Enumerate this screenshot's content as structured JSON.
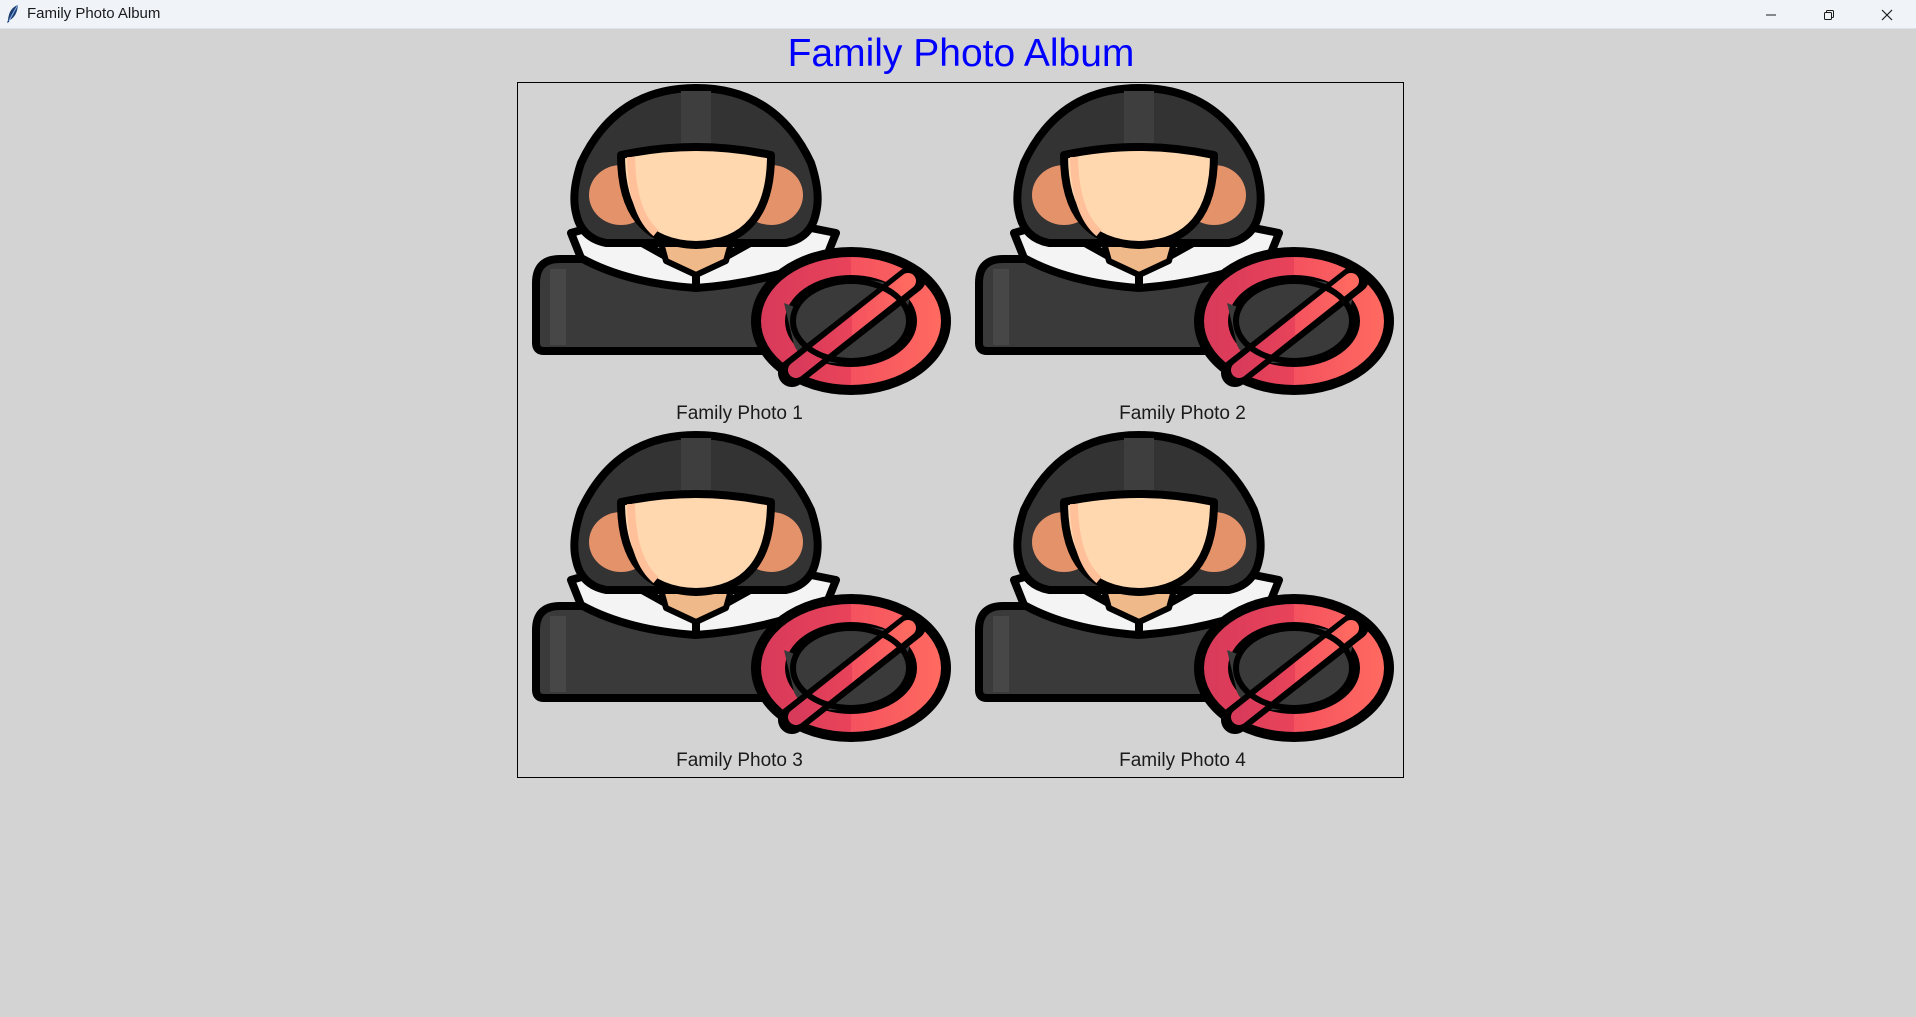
{
  "window": {
    "title": "Family Photo Album",
    "app_icon": "feather-icon",
    "controls": {
      "minimize_icon": "minimize-icon",
      "maximize_icon": "restore-icon",
      "close_icon": "close-icon"
    }
  },
  "album": {
    "heading": "Family Photo Album",
    "heading_color": "#0000ff",
    "photos": [
      {
        "caption": "Family Photo 1",
        "image_icon": "anonymous-user-blocked-icon"
      },
      {
        "caption": "Family Photo 2",
        "image_icon": "anonymous-user-blocked-icon"
      },
      {
        "caption": "Family Photo 3",
        "image_icon": "anonymous-user-blocked-icon"
      },
      {
        "caption": "Family Photo 4",
        "image_icon": "anonymous-user-blocked-icon"
      }
    ]
  },
  "colors": {
    "background": "#d3d3d3",
    "hood": "#333333",
    "skin": "#ffd8b0",
    "ban_red": "#e8435a"
  }
}
